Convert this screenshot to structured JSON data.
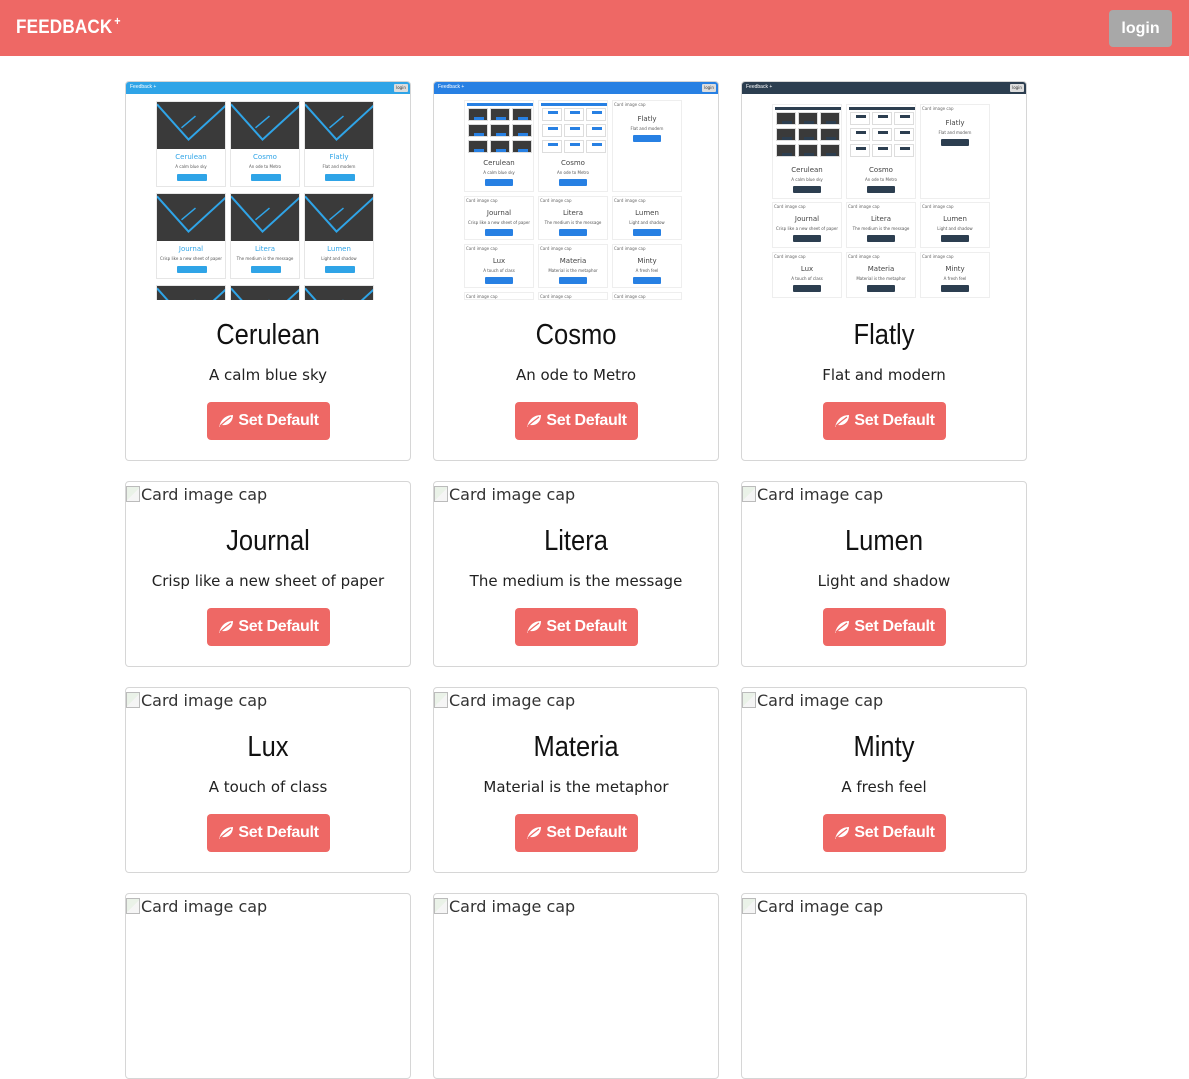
{
  "navbar": {
    "brand": "FEEDBACK",
    "brand_mark": "+",
    "login_label": "login"
  },
  "colors": {
    "primary": "#ee6865",
    "login_bg": "#a8a8a8",
    "card_border": "#d6d6d6"
  },
  "image_alt": "Card image cap",
  "button_label": "Set Default",
  "cards": [
    {
      "title": "Cerulean",
      "description": "A calm blue sky"
    },
    {
      "title": "Cosmo",
      "description": "An ode to Metro"
    },
    {
      "title": "Flatly",
      "description": "Flat and modern"
    },
    {
      "title": "Journal",
      "description": "Crisp like a new sheet of paper"
    },
    {
      "title": "Litera",
      "description": "The medium is the message"
    },
    {
      "title": "Lumen",
      "description": "Light and shadow"
    },
    {
      "title": "Lux",
      "description": "A touch of class"
    },
    {
      "title": "Materia",
      "description": "Material is the metaphor"
    },
    {
      "title": "Minty",
      "description": "A fresh feel"
    },
    {
      "title": "",
      "description": ""
    },
    {
      "title": "",
      "description": ""
    },
    {
      "title": "",
      "description": ""
    }
  ],
  "thumb_labels": {
    "brand": "Feedback +",
    "login": "login",
    "set_default": "Set Default",
    "alt": "Card image cap",
    "cerulean": {
      "theme": "cerulean",
      "nav_color": "#2fa4e7",
      "accent": "#2fa4e7"
    },
    "cosmo": {
      "theme": "cosmo",
      "nav_color": "#2780e3",
      "accent": "#2780e3"
    },
    "flatly": {
      "theme": "flatly",
      "nav_color": "#2c3e50",
      "accent": "#2c3e50"
    }
  }
}
